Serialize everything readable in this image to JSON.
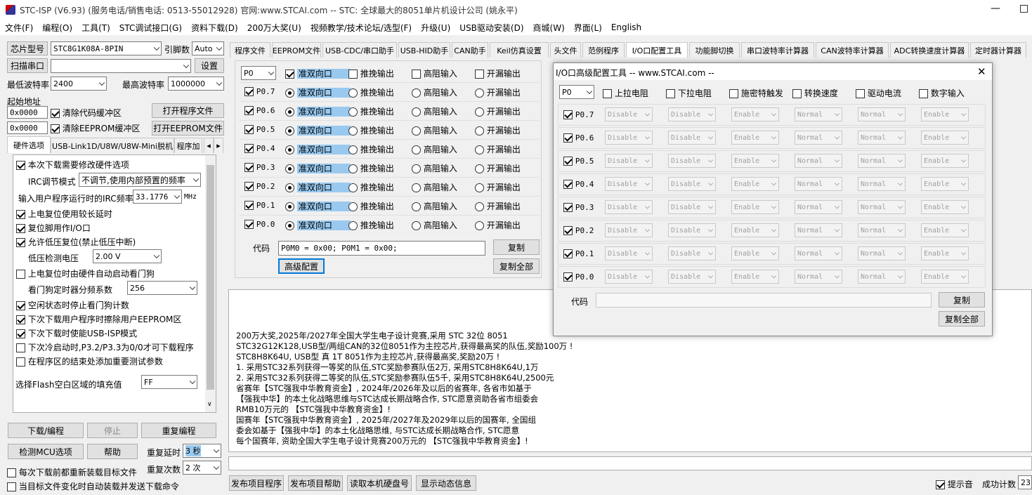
{
  "title": "STC-ISP (V6.93) (服务电话/销售电话: 0513-55012928) 官网:www.STCAI.com  -- STC: 全球最大的8051单片机设计公司 (姚永平)",
  "menu": [
    "文件(F)",
    "编程(O)",
    "工具(T)",
    "STC调试接口(G)",
    "资料下载(D)",
    "200万大奖(U)",
    "视频教学/技术论坛/选型(F)",
    "升级(U)",
    "USB驱动安装(D)",
    "商城(W)",
    "界面(L)",
    "English"
  ],
  "left": {
    "chip_label": "芯片型号",
    "chip_value": "STC8G1K08A-8PIN",
    "pin_label": "引脚数",
    "pin_value": "Auto",
    "scan_button": "扫描串口",
    "settings_button": "设置",
    "min_baud_label": "最低波特率",
    "min_baud": "2400",
    "max_baud_label": "最高波特率",
    "max_baud": "1000000",
    "start_addr_label": "起始地址",
    "addr1": "0x0000",
    "clear_code": "清除代码缓冲区",
    "open_prog": "打开程序文件",
    "addr2": "0x0000",
    "clear_eeprom": "清除EEPROM缓冲区",
    "open_eeprom": "打开EEPROM文件",
    "tabs": [
      "硬件选项",
      "USB-Link1D/U8W/U8W-Mini脱机",
      "程序加"
    ],
    "opt_modify": "本次下载需要修改硬件选项",
    "irc_label": "IRC调节模式",
    "irc_value": "不调节,使用内部预置的频率",
    "irc_freq_label": "输入用户程序运行时的IRC频率",
    "irc_freq": "33.1776",
    "mhz": "MHz",
    "opts": [
      "上电复位使用较长延时",
      "复位脚用作I/O口",
      "允许低压复位(禁止低压中断)"
    ],
    "lv_label": "低压检测电压",
    "lv_value": "2.00 V",
    "wdt_auto": "上电复位时由硬件自动启动看门狗",
    "wdt_div_label": "看门狗定时器分频系数",
    "wdt_div": "256",
    "opts2": [
      {
        "label": "空闲状态时停止看门狗计数",
        "on": true
      },
      {
        "label": "下次下载用户程序时擦除用户EEPROM区",
        "on": true
      },
      {
        "label": "下次下载时使能USB-ISP模式",
        "on": true
      },
      {
        "label": "下次冷启动时,P3.2/P3.3为0/0才可下载程序",
        "on": false
      },
      {
        "label": "在程序区的结束处添加重要测试参数",
        "on": false
      }
    ],
    "fill_label": "选择Flash空白区域的填充值",
    "fill_value": "FF",
    "download": "下载/编程",
    "stop": "停止",
    "reprogram": "重复编程",
    "check_mcu": "检测MCU选项",
    "help": "帮助",
    "repeat_delay_label": "重复延时",
    "repeat_delay": "3 秒",
    "repeat_count_label": "重复次数",
    "repeat_count": "2 次",
    "reload_each": "每次下载前都重新装载目标文件",
    "auto_send": "当目标文件变化时自动装载并发送下载命令"
  },
  "top_tabs": [
    "程序文件",
    "EEPROM文件",
    "USB-CDC/串口助手",
    "USB-HID助手",
    "CAN助手",
    "Keil仿真设置",
    "头文件",
    "范例程序",
    "I/O口配置工具",
    "功能脚切换",
    "串口波特率计算器",
    "CAN波特率计算器",
    "ADC转换速度计算器",
    "定时器计算器"
  ],
  "io": {
    "port": "P0",
    "head": [
      "准双向口",
      "推挽输出",
      "高阻输入",
      "开漏输出"
    ],
    "pins": [
      "P0.7",
      "P0.6",
      "P0.5",
      "P0.4",
      "P0.3",
      "P0.2",
      "P0.1",
      "P0.0"
    ],
    "code_label": "代码",
    "code": "P0M0 = 0x00; P0M1 = 0x00;",
    "copy": "复制",
    "advanced": "高级配置",
    "copy_all": "复制全部"
  },
  "dialog": {
    "title": "I/O口高级配置工具 -- www.STCAI.com --",
    "close": "✕",
    "port": "P0",
    "head": [
      "上拉电阻",
      "下拉电阻",
      "施密特触发",
      "转换速度",
      "驱动电流",
      "数字输入"
    ],
    "cols": [
      "Disable",
      "Disable",
      "Enable",
      "Normal",
      "Normal",
      "Enable"
    ],
    "code_label": "代码",
    "copy": "复制",
    "copy_all": "复制全部"
  },
  "log_lines": [
    "200万大奖,2025年/2027年全国大学生电子设计竞赛,采用 STC 32位 8051",
    "STC32G12K128,USB型/两组CAN的32位8051作为主控芯片,获得最高奖的队伍,奖励100万 !",
    "STC8H8K64U, USB型 真 1T 8051作为主控芯片,获得最高奖,奖励20万 !",
    "1. 采用STC32系列获得一等奖的队伍,STC奖励参赛队伍2万, 采用STC8H8K64U,1万",
    "2. 采用STC32系列获得二等奖的队伍,STC奖励参赛队伍5千, 采用STC8H8K64U,2500元",
    "省赛年【STC强我中华教育资金】, 2024年/2026年及以后的省赛年, 各省市如基于",
    "【强我中华】的本土化战略思维与STC达成长期战略合作, STC愿意资助各省市组委会",
    "RMB10万元的 【STC强我中华教育资金】!",
    "国赛年【STC强我中华教育资金】, 2025年/2027年及2029年以后的国赛年, 全国组",
    "委会如基于【强我中华】的本土化战略思维, 与STC达成长期战略合作, STC愿意",
    "每个国赛年, 资助全国大学生电子设计竞赛200万元的 【STC强我中华教育资金】!"
  ],
  "bottom": {
    "b1": "发布项目程序",
    "b2": "发布项目帮助",
    "b3": "读取本机硬盘号",
    "b4": "显示动态信息",
    "tip": "提示音",
    "count_label": "成功计数",
    "count": "23"
  }
}
